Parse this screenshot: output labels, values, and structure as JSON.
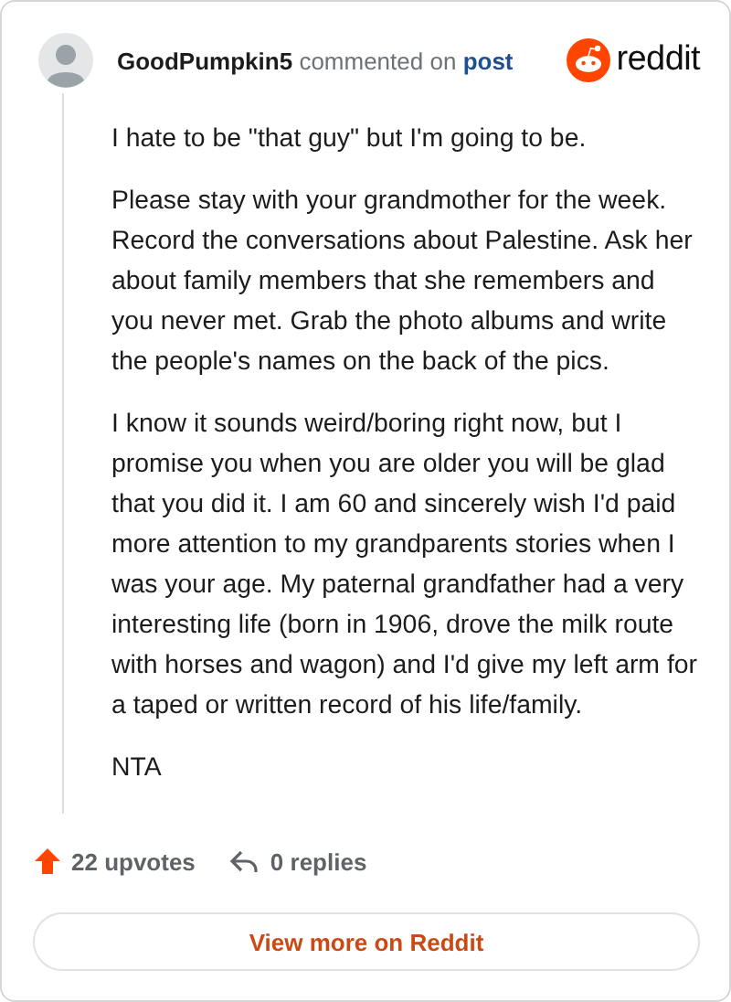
{
  "header": {
    "username": "GoodPumpkin5",
    "action": "commented on",
    "link": "post",
    "brand": "reddit"
  },
  "comment": {
    "paragraphs": [
      "I hate to be \"that guy\" but I'm going to be.",
      "Please stay with your grandmother for the week. Record the conversations about Palestine. Ask her about family members that she remembers and you never met. Grab the photo albums and write the people's names on the back of the pics.",
      "I know it sounds weird/boring right now, but I promise you when you are older you will be glad that you did it. I am 60 and sincerely wish I'd paid more attention to my grandparents stories when I was your age. My paternal grandfather had a very interesting life (born in 1906, drove the milk route with horses and wagon) and I'd give my left arm for a taped or written record of his life/family.",
      "NTA"
    ]
  },
  "footer": {
    "upvotes": "22 upvotes",
    "replies": "0 replies",
    "button": "View more on Reddit"
  }
}
